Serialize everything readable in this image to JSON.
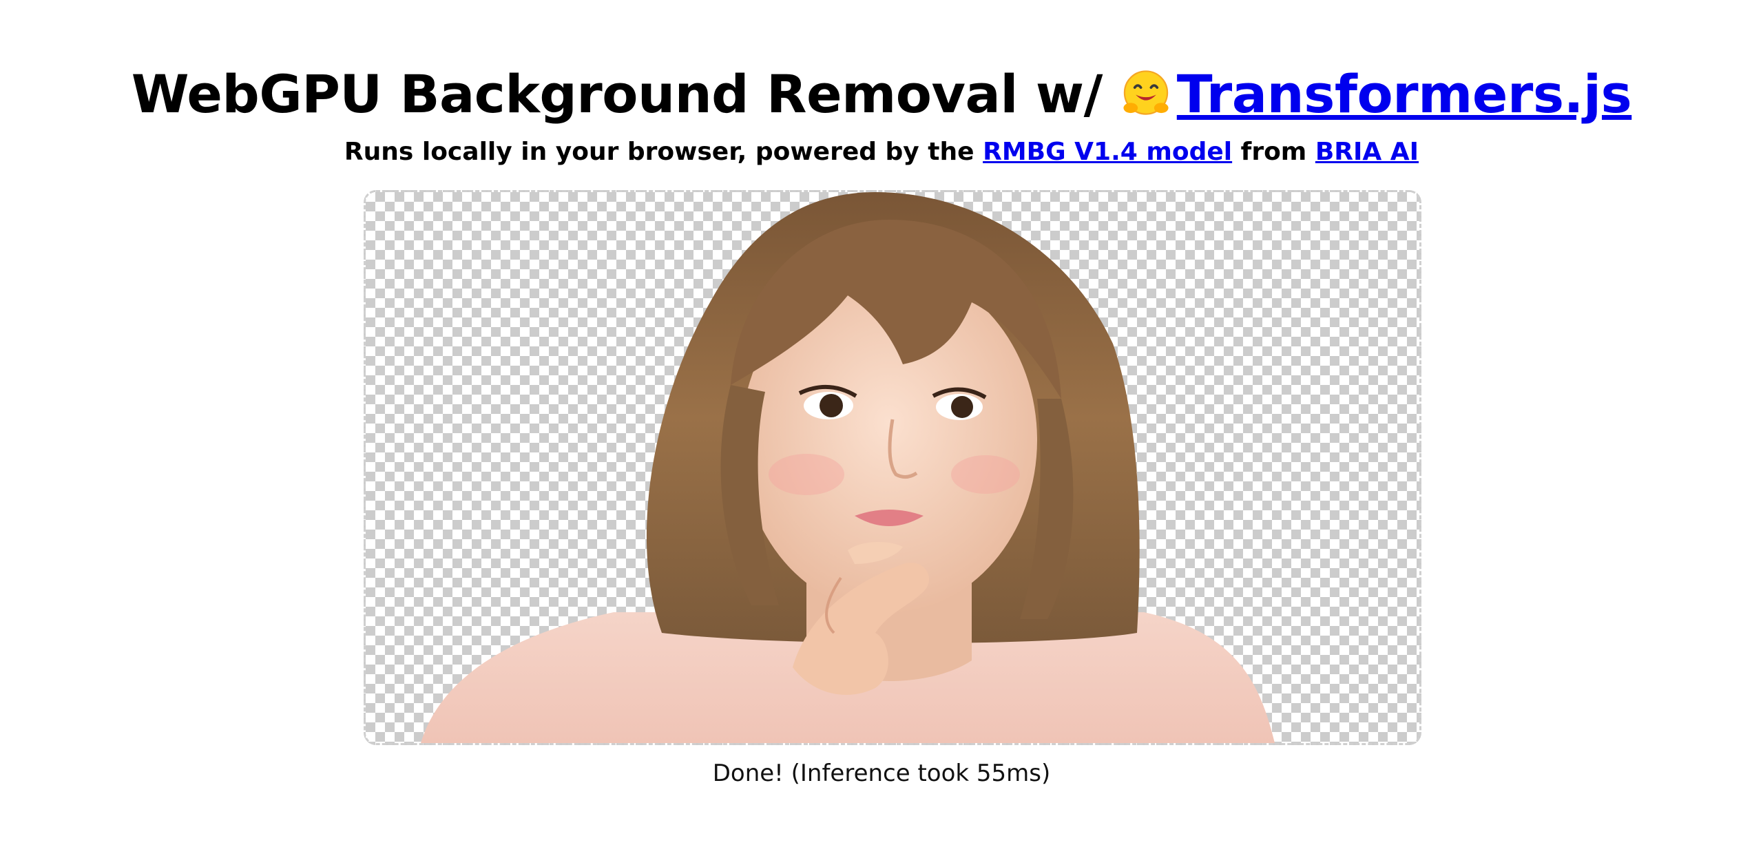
{
  "header": {
    "title_prefix": "WebGPU Background Removal w/ ",
    "title_link": "Transformers.js",
    "emoji_icon": "hugging-face-emoji"
  },
  "subtitle": {
    "prefix": "Runs locally in your browser, powered by the ",
    "model_link": "RMBG V1.4 model",
    "middle": " from ",
    "org_link": "BRIA AI"
  },
  "result": {
    "status": "Done! (Inference took 55ms)"
  },
  "colors": {
    "link": "#0000ee",
    "checker": "#cccccc"
  }
}
